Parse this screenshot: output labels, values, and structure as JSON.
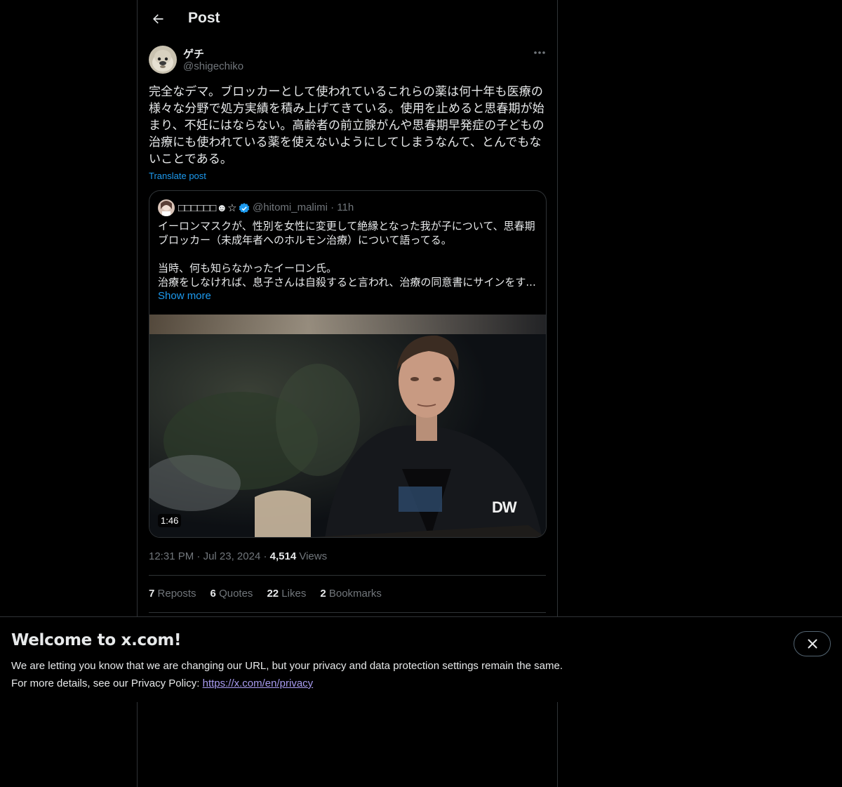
{
  "header": {
    "title": "Post"
  },
  "post": {
    "display_name": "ゲチ",
    "handle": "@shigechiko",
    "text": "完全なデマ。ブロッカーとして使われているこれらの薬は何十年も医療の様々な分野で処方実績を積み上げてきている。使用を止めると思春期が始まり、不妊にはならない。高齢者の前立腺がんや思春期早発症の子どもの治療にも使われている薬を使えないようにしてしまうなんて、とんでもないことである。",
    "translate_label": "Translate post",
    "time": "12:31 PM",
    "date": "Jul 23, 2024",
    "views_count": "4,514",
    "views_label": "Views",
    "stats": [
      {
        "count": "7",
        "label": "Reposts"
      },
      {
        "count": "6",
        "label": "Quotes"
      },
      {
        "count": "22",
        "label": "Likes"
      },
      {
        "count": "2",
        "label": "Bookmarks"
      }
    ]
  },
  "quote": {
    "display_name": "□□□□□□☻☆",
    "handle": "@hitomi_malimi",
    "age": "11h",
    "lines": [
      "イーロンマスクが、性別を女性に変更して絶縁となった我が子について、思春期",
      "ブロッカー（未成年者へのホルモン治療）について語ってる。",
      "",
      "当時、何も知らなかったイーロン氏。",
      "治療をしなければ、息子さんは自殺すると言われ、治療の同意書にサインをす..."
    ],
    "show_more": "Show more",
    "video_duration": "1:46",
    "watermark": "DW"
  },
  "banner": {
    "title": "Welcome to x.com!",
    "line1": "We are letting you know that we are changing our URL, but your privacy and data protection settings remain the same.",
    "line2_prefix": "For more details, see our Privacy Policy:",
    "link": "https://x.com/en/privacy"
  },
  "colors": {
    "accent": "#1d9bf0",
    "border": "#2f3336",
    "muted": "#71767b",
    "background": "#000000"
  },
  "icons": {
    "back": "arrow-left-icon",
    "more": "more-dots-icon",
    "verified": "verified-badge-icon",
    "close": "close-icon"
  }
}
